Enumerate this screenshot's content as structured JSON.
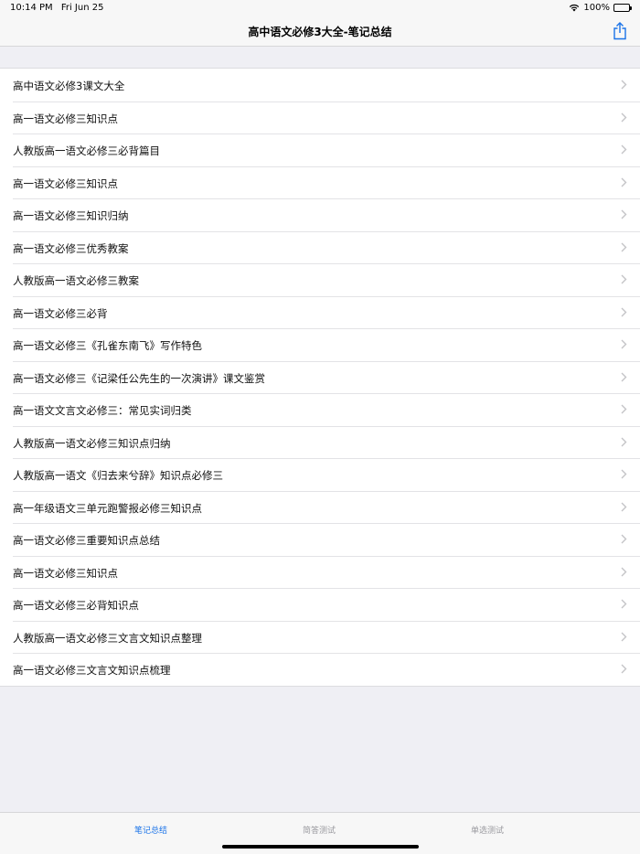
{
  "status_bar": {
    "time": "10:14 PM",
    "date": "Fri Jun 25",
    "battery": "100%"
  },
  "nav": {
    "title": "高中语文必修3大全-笔记总结",
    "share_icon": "share-icon"
  },
  "list": {
    "items": [
      {
        "label": "高中语文必修3课文大全"
      },
      {
        "label": "高一语文必修三知识点"
      },
      {
        "label": "人教版高一语文必修三必背篇目"
      },
      {
        "label": "高一语文必修三知识点"
      },
      {
        "label": "高一语文必修三知识归纳"
      },
      {
        "label": "高一语文必修三优秀教案"
      },
      {
        "label": "人教版高一语文必修三教案"
      },
      {
        "label": "高一语文必修三必背"
      },
      {
        "label": "高一语文必修三《孔雀东南飞》写作特色"
      },
      {
        "label": "高一语文必修三《记梁任公先生的一次演讲》课文鉴赏"
      },
      {
        "label": "高一语文文言文必修三：常见实词归类"
      },
      {
        "label": "人教版高一语文必修三知识点归纳"
      },
      {
        "label": "人教版高一语文《归去来兮辞》知识点必修三"
      },
      {
        "label": "高一年级语文三单元跑警报必修三知识点"
      },
      {
        "label": "高一语文必修三重要知识点总结"
      },
      {
        "label": "高一语文必修三知识点"
      },
      {
        "label": "高一语文必修三必背知识点"
      },
      {
        "label": "人教版高一语文必修三文言文知识点整理"
      },
      {
        "label": "高一语文必修三文言文知识点梳理"
      }
    ]
  },
  "tabs": [
    {
      "label": "笔记总结",
      "active": true
    },
    {
      "label": "简答测试",
      "active": false
    },
    {
      "label": "单选测试",
      "active": false
    }
  ],
  "colors": {
    "accent": "#1a73e8",
    "inactive": "#9a9a9f",
    "background": "#efeff4"
  }
}
